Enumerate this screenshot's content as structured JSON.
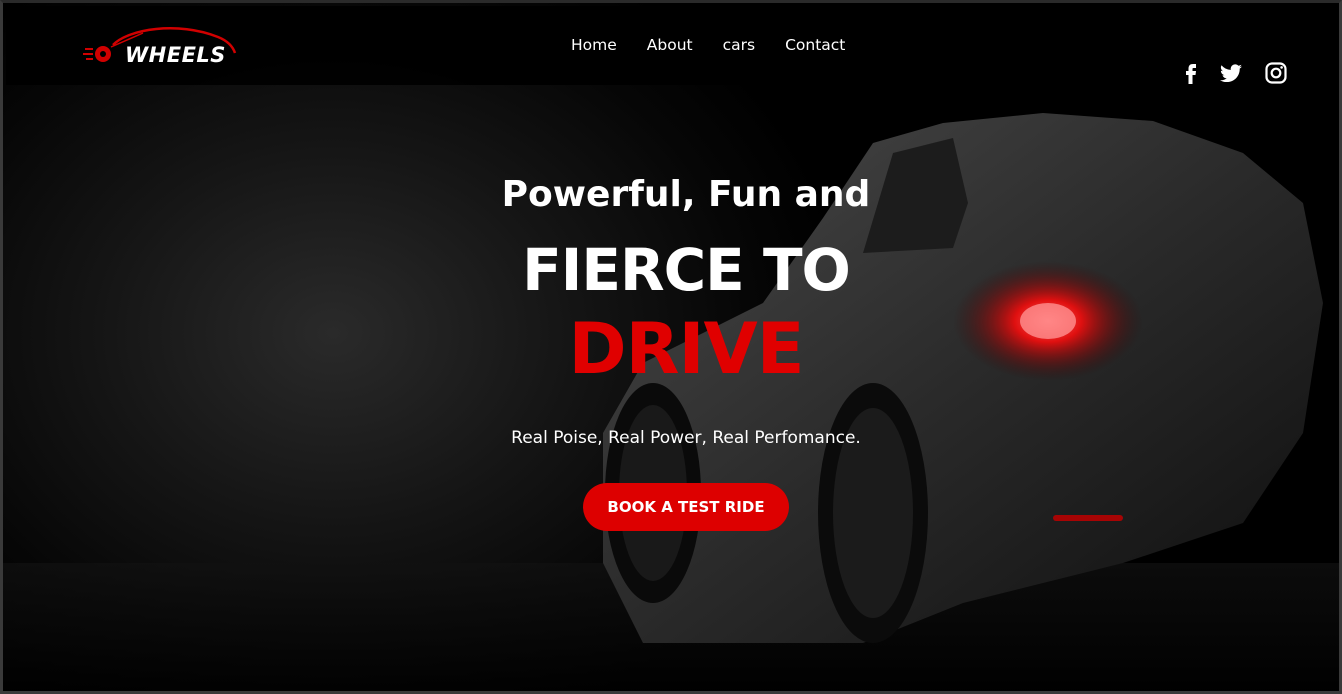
{
  "brand": {
    "logo_text": "WHEELS",
    "accent_color": "#e00000"
  },
  "nav": {
    "items": [
      {
        "label": "Home"
      },
      {
        "label": "About"
      },
      {
        "label": "cars"
      },
      {
        "label": "Contact"
      }
    ]
  },
  "socials": [
    {
      "icon": "facebook-icon"
    },
    {
      "icon": "twitter-icon"
    },
    {
      "icon": "instagram-icon"
    }
  ],
  "hero": {
    "kicker": "Powerful, Fun and",
    "headline": "FIERCE TO",
    "headline_accent": "DRIVE",
    "tagline": "Real Poise, Real Power, Real Perfomance.",
    "cta_label": "BOOK A TEST RIDE"
  },
  "colors": {
    "primary_red": "#dd0000",
    "background": "#000000",
    "text": "#ffffff"
  }
}
